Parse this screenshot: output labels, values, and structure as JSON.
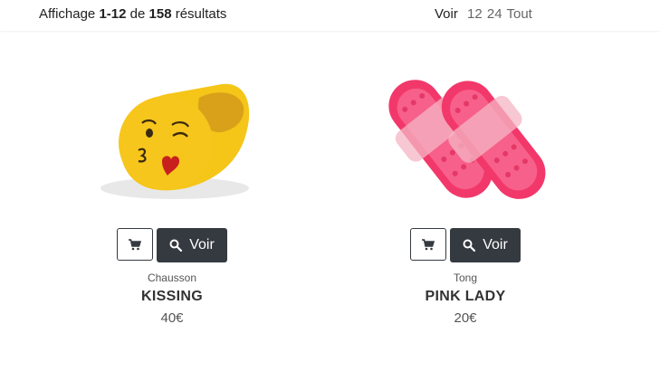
{
  "toolbar": {
    "result_prefix": "Affichage ",
    "result_range": "1-12",
    "result_of": " de ",
    "result_total": "158",
    "result_suffix": " résultats",
    "perpage_label": "Voir",
    "perpage_options": [
      "12",
      "24",
      "Tout"
    ]
  },
  "products": [
    {
      "category": "Chausson",
      "name": "KISSING",
      "price": "40€",
      "image_icon": "emoji-slipper-icon",
      "view_label": "Voir"
    },
    {
      "category": "Tong",
      "name": "PINK LADY",
      "price": "20€",
      "image_icon": "pink-sandals-icon",
      "view_label": "Voir"
    }
  ],
  "icons": {
    "cart": "cart-icon",
    "search": "search-icon"
  },
  "colors": {
    "button_dark": "#343a40",
    "slipper_yellow": "#f5c518",
    "sandal_pink": "#f2386a"
  }
}
